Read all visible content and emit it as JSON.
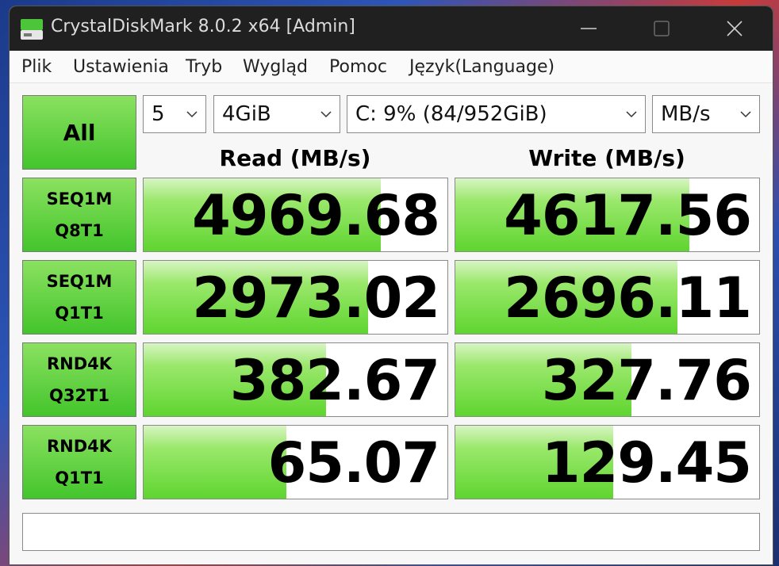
{
  "window": {
    "title": "CrystalDiskMark 8.0.2 x64 [Admin]"
  },
  "titlebar_icons": [
    "app-icon",
    "minimize-icon",
    "maximize-icon",
    "close-icon"
  ],
  "menu": [
    "Plik",
    "Ustawienia",
    "Tryb",
    "Wygląd",
    "Pomoc",
    "Język(Language)"
  ],
  "controls": {
    "all_label": "All",
    "count": "5",
    "size": "4GiB",
    "drive": "C: 9% (84/952GiB)",
    "unit": "MB/s"
  },
  "headers": {
    "read": "Read (MB/s)",
    "write": "Write (MB/s)"
  },
  "rows": [
    {
      "line1": "SEQ1M",
      "line2": "Q8T1",
      "read": "4969.68",
      "write": "4617.56",
      "read_fill": 0.78,
      "write_fill": 0.77
    },
    {
      "line1": "SEQ1M",
      "line2": "Q1T1",
      "read": "2973.02",
      "write": "2696.11",
      "read_fill": 0.74,
      "write_fill": 0.73
    },
    {
      "line1": "RND4K",
      "line2": "Q32T1",
      "read": "382.67",
      "write": "327.76",
      "read_fill": 0.6,
      "write_fill": 0.58
    },
    {
      "line1": "RND4K",
      "line2": "Q1T1",
      "read": "65.07",
      "write": "129.45",
      "read_fill": 0.47,
      "write_fill": 0.52
    }
  ],
  "comment": "",
  "colors": {
    "accent_green": "#43c52c",
    "titlebar": "#202020"
  }
}
